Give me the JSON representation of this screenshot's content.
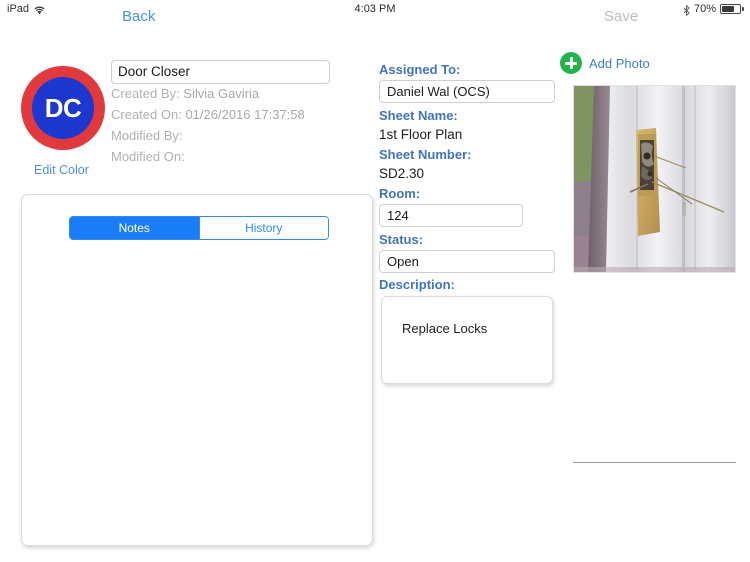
{
  "statusbar": {
    "device": "iPad",
    "wifi_icon": "wifi-icon",
    "time": "4:03 PM",
    "bluetooth_icon": "bluetooth-icon",
    "battery_percent": "70%",
    "battery_level": 70
  },
  "navbar": {
    "back_label": "Back",
    "save_label": "Save"
  },
  "left": {
    "logo_text": "DC",
    "logo_ring_color": "#e03a3f",
    "logo_inner_color": "#1c38cf",
    "edit_color_label": "Edit Color",
    "title_value": "Door Closer",
    "created_by_label": "Created By:",
    "created_by_value": "Silvia Gaviria",
    "created_on_label": "Created On:",
    "created_on_value": "01/26/2016 17:37:58",
    "modified_by_label": "Modified By:",
    "modified_by_value": "",
    "modified_on_label": "Modified On:",
    "modified_on_value": ""
  },
  "notes_panel": {
    "tabs": [
      {
        "label": "Notes",
        "selected": true
      },
      {
        "label": "History",
        "selected": false
      }
    ],
    "body_text": ""
  },
  "details": {
    "assigned_to_label": "Assigned To:",
    "assigned_to_value": "Daniel Wal (OCS)",
    "sheet_name_label": "Sheet Name:",
    "sheet_name_value": "1st Floor Plan",
    "sheet_number_label": "Sheet Number:",
    "sheet_number_value": "SD2.30",
    "room_label": "Room:",
    "room_value": "124",
    "status_label": "Status:",
    "status_value": "Open",
    "description_label": "Description:",
    "description_value": "Replace Locks",
    "label_color": "#4274be"
  },
  "photos": {
    "add_photo_label": "Add Photo",
    "add_photo_icon": "plus-circle-icon",
    "add_photo_icon_color": "#22b34b",
    "thumbnail_alt": "Door with damaged lock mortise"
  }
}
